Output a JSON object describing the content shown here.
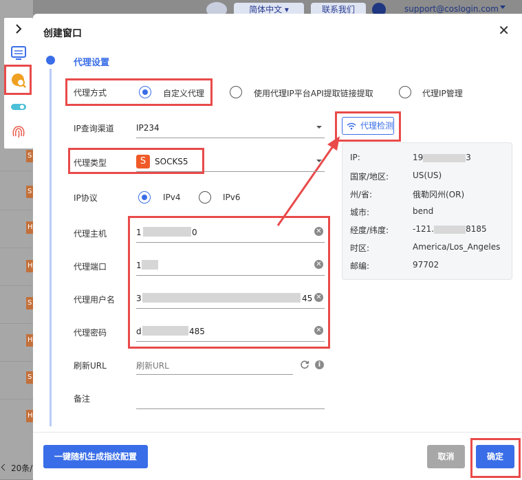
{
  "header": {
    "language": "简体中文",
    "contact": "联系我们",
    "email": "support@coslogin.com"
  },
  "background": {
    "pagination_text": "20条/",
    "row_tags": [
      "S",
      "S",
      "H",
      "H",
      "S",
      "H",
      "S",
      "H"
    ]
  },
  "dialog": {
    "title": "创建窗口",
    "section_title": "代理设置",
    "proxy_mode": {
      "label": "代理方式",
      "options": [
        "自定义代理",
        "使用代理IP平台API提取链接提取",
        "代理IP管理"
      ],
      "selected": "自定义代理"
    },
    "ip_channel": {
      "label": "IP查询渠道",
      "value": "IP234"
    },
    "proxy_type": {
      "label": "代理类型",
      "value": "SOCKS5",
      "icon_letter": "S"
    },
    "ip_protocol": {
      "label": "IP协议",
      "options": [
        "IPv4",
        "IPv6"
      ],
      "selected": "IPv4"
    },
    "proxy_host": {
      "label": "代理主机",
      "value_start": "1",
      "value_end": "0"
    },
    "proxy_port": {
      "label": "代理端口",
      "value_start": "1"
    },
    "proxy_user": {
      "label": "代理用户名",
      "value_start": "3",
      "value_end": "45"
    },
    "proxy_password": {
      "label": "代理密码",
      "value_start": "d",
      "value_end": "485"
    },
    "refresh_url": {
      "label": "刷新URL",
      "placeholder": "刷新URL"
    },
    "remark": {
      "label": "备注"
    },
    "check_button": "代理检测",
    "check_result": {
      "ip_label": "IP:",
      "ip_value_start": "19",
      "ip_value_end": "3",
      "country_label": "国家/地区:",
      "country_value": "US(US)",
      "state_label": "州/省:",
      "state_value": "俄勒冈州(OR)",
      "city_label": "城市:",
      "city_value": "bend",
      "lnglat_label": "经度/纬度:",
      "lnglat_value_start": "-121.",
      "lnglat_value_end": "8185",
      "tz_label": "时区:",
      "tz_value": "America/Los_Angeles",
      "zip_label": "邮编:",
      "zip_value": "97702"
    },
    "footer": {
      "generate_button": "一键随机生成指纹配置",
      "cancel_button": "取消",
      "confirm_button": "确定"
    }
  },
  "colors": {
    "accent": "#3a6ee8",
    "highlight": "#e94a4a",
    "socks_icon": "#f05a28"
  }
}
